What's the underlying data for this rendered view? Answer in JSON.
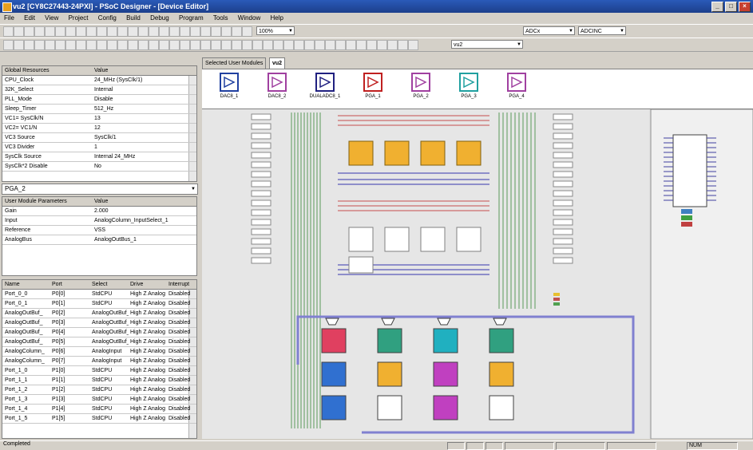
{
  "window": {
    "title": "vu2 [CY8C27443-24PXI] - PSoC Designer - [Device Editor]"
  },
  "menu": [
    "File",
    "Edit",
    "View",
    "Project",
    "Config",
    "Build",
    "Debug",
    "Program",
    "Tools",
    "Window",
    "Help"
  ],
  "toolbar": {
    "zoom": "100%",
    "select_left": "ADCx",
    "select_right": "ADCINC",
    "file_combo": "vu2"
  },
  "global_resources": {
    "headers": [
      "Global Resources",
      "Value"
    ],
    "rows": [
      [
        "CPU_Clock",
        "24_MHz (SysClk/1)"
      ],
      [
        "32K_Select",
        "Internal"
      ],
      [
        "PLL_Mode",
        "Disable"
      ],
      [
        "Sleep_Timer",
        "512_Hz"
      ],
      [
        "VC1= SysClk/N",
        "13"
      ],
      [
        "VC2= VC1/N",
        "12"
      ],
      [
        "VC3 Source",
        "SysClk/1"
      ],
      [
        "VC3 Divider",
        "1"
      ],
      [
        "SysClk Source",
        "Internal 24_MHz"
      ],
      [
        "SysClk*2 Disable",
        "No"
      ]
    ]
  },
  "module_select": "PGA_2",
  "module_params": {
    "headers": [
      "User Module Parameters",
      "Value"
    ],
    "rows": [
      [
        "Gain",
        "2.000"
      ],
      [
        "Input",
        "AnalogColumn_InputSelect_1"
      ],
      [
        "Reference",
        "VSS"
      ],
      [
        "AnalogBus",
        "AnalogOutBus_1"
      ]
    ]
  },
  "pins": {
    "headers": [
      "Name",
      "Port",
      "Select",
      "Drive",
      "Interrupt"
    ],
    "rows": [
      [
        "Port_0_0",
        "P0[0]",
        "StdCPU",
        "High Z Analog",
        "Disabled"
      ],
      [
        "Port_0_1",
        "P0[1]",
        "StdCPU",
        "High Z Analog",
        "Disabled"
      ],
      [
        "AnalogOutBuf_",
        "P0[2]",
        "AnalogOutBuf_",
        "High Z Analog",
        "Disabled"
      ],
      [
        "AnalogOutBuf_",
        "P0[3]",
        "AnalogOutBuf_",
        "High Z Analog",
        "Disabled"
      ],
      [
        "AnalogOutBuf_",
        "P0[4]",
        "AnalogOutBuf_",
        "High Z Analog",
        "Disabled"
      ],
      [
        "AnalogOutBuf_",
        "P0[5]",
        "AnalogOutBuf_",
        "High Z Analog",
        "Disabled"
      ],
      [
        "AnalogColumn_",
        "P0[6]",
        "AnalogInput",
        "High Z Analog",
        "Disabled"
      ],
      [
        "AnalogColumn_",
        "P0[7]",
        "AnalogInput",
        "High Z Analog",
        "Disabled"
      ],
      [
        "Port_1_0",
        "P1[0]",
        "StdCPU",
        "High Z Analog",
        "Disabled"
      ],
      [
        "Port_1_1",
        "P1[1]",
        "StdCPU",
        "High Z Analog",
        "Disabled"
      ],
      [
        "Port_1_2",
        "P1[2]",
        "StdCPU",
        "High Z Analog",
        "Disabled"
      ],
      [
        "Port_1_3",
        "P1[3]",
        "StdCPU",
        "High Z Analog",
        "Disabled"
      ],
      [
        "Port_1_4",
        "P1[4]",
        "StdCPU",
        "High Z Analog",
        "Disabled"
      ],
      [
        "Port_1_5",
        "P1[5]",
        "StdCPU",
        "High Z Analog",
        "Disabled"
      ]
    ]
  },
  "tabs": [
    "Selected User Modules",
    "vu2"
  ],
  "modules": [
    {
      "name": "DAC8_1",
      "color": "#2040a0"
    },
    {
      "name": "DAC8_2",
      "color": "#a040a0"
    },
    {
      "name": "DUALADC8_1",
      "color": "#202080"
    },
    {
      "name": "PGA_1",
      "color": "#c02020"
    },
    {
      "name": "PGA_2",
      "color": "#a040a0"
    },
    {
      "name": "PGA_3",
      "color": "#20a0a0"
    },
    {
      "name": "PGA_4",
      "color": "#a040a0"
    }
  ],
  "status": {
    "left": "Completed",
    "right": "NUM"
  },
  "colors": {
    "block_orange": "#f0b030",
    "block_red": "#e04060",
    "block_blue": "#3070d0",
    "block_magenta": "#c040c0",
    "block_cyan": "#20b0c0",
    "block_green": "#30a080"
  }
}
